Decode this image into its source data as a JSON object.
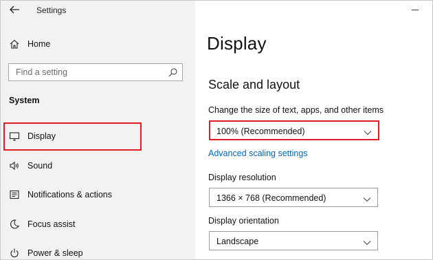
{
  "window": {
    "title": "Settings"
  },
  "sidebar": {
    "home_label": "Home",
    "search_placeholder": "Find a setting",
    "section_label": "System",
    "items": [
      {
        "label": "Display",
        "icon": "monitor-icon"
      },
      {
        "label": "Sound",
        "icon": "speaker-icon"
      },
      {
        "label": "Notifications & actions",
        "icon": "notification-icon"
      },
      {
        "label": "Focus assist",
        "icon": "moon-icon"
      },
      {
        "label": "Power & sleep",
        "icon": "power-icon"
      }
    ]
  },
  "main": {
    "page_title": "Display",
    "section_title": "Scale and layout",
    "scale_label": "Change the size of text, apps, and other items",
    "scale_value": "100% (Recommended)",
    "advanced_link": "Advanced scaling settings",
    "resolution_label": "Display resolution",
    "resolution_value": "1366 × 768 (Recommended)",
    "orientation_label": "Display orientation",
    "orientation_value": "Landscape"
  },
  "colors": {
    "highlight": "#e21b23",
    "link": "#0067c0",
    "sidebar_bg": "#f2f2f2"
  }
}
